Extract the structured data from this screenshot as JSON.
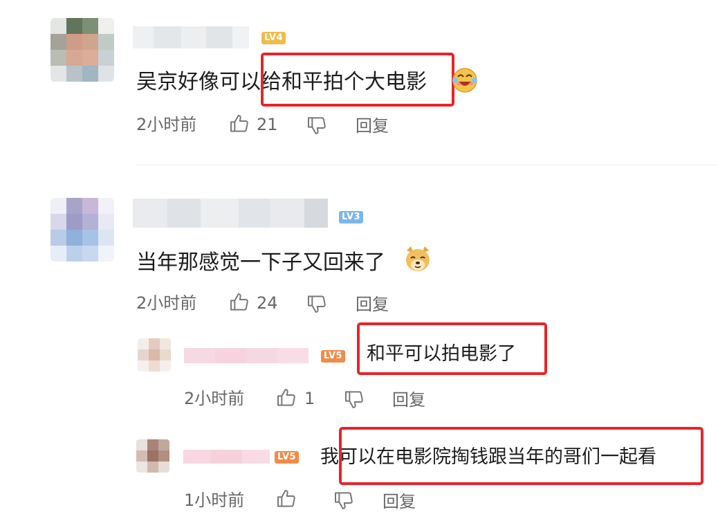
{
  "comments": [
    {
      "text": "吴京好像可以给和平拍个大电影",
      "level": "LV4",
      "time": "2小时前",
      "likes": "21",
      "reply_label": "回复"
    },
    {
      "text": "当年那感觉一下子又回来了",
      "level": "LV3",
      "time": "2小时前",
      "likes": "24",
      "reply_label": "回复",
      "replies": [
        {
          "text": "和平可以拍电影了",
          "level": "LV5",
          "time": "2小时前",
          "likes": "1",
          "reply_label": "回复"
        },
        {
          "text": "我可以在电影院掏钱跟当年的哥们一起看",
          "level": "LV5",
          "time": "1小时前",
          "likes": "",
          "reply_label": "回复"
        }
      ]
    }
  ],
  "colors": {
    "highlight_border": "#e8232a",
    "lv4_badge": "#f3b94a",
    "lv3_badge": "#79b6ea",
    "lv5_badge": "#f08b4a",
    "meta_text": "#666666"
  },
  "icons": [
    "thumbs-up-icon",
    "thumbs-down-icon",
    "laughing-emoji",
    "doge-emoji"
  ]
}
